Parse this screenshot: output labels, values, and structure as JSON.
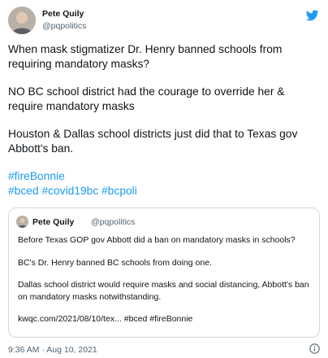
{
  "tweet": {
    "author_name": "Pete Quily",
    "author_handle": "@pqpolitics",
    "paragraphs": [
      "When mask stigmatizer Dr. Henry banned schools from requiring mandatory masks?",
      "NO BC school district had the courage to override her & require mandatory masks",
      "Houston & Dallas school districts just did that to Texas gov Abbott's ban."
    ],
    "hashtag_line_1": [
      "#fireBonnie"
    ],
    "hashtag_line_2": [
      "#bced",
      "#covid19bc",
      "#bcpoli"
    ],
    "timestamp": "9:36 AM · Aug 10, 2021"
  },
  "quoted_tweet": {
    "author_name": "Pete Quily",
    "author_handle": "@pqpolitics",
    "paragraphs": [
      "Before Texas GOP gov Abbott did a ban on mandatory masks in schools?",
      "BC's Dr. Henry banned BC schools from doing one.",
      "Dallas school district would require masks and social distancing, Abbott's ban on mandatory masks notwithstanding.",
      "kwqc.com/2021/08/10/tex... #bced #fireBonnie"
    ]
  },
  "colors": {
    "link": "#1d9bf0",
    "text": "#0f1419",
    "muted": "#536471",
    "border": "#cfd9de"
  },
  "icons": {
    "brand": "twitter-bird-icon",
    "info": "info-icon"
  }
}
